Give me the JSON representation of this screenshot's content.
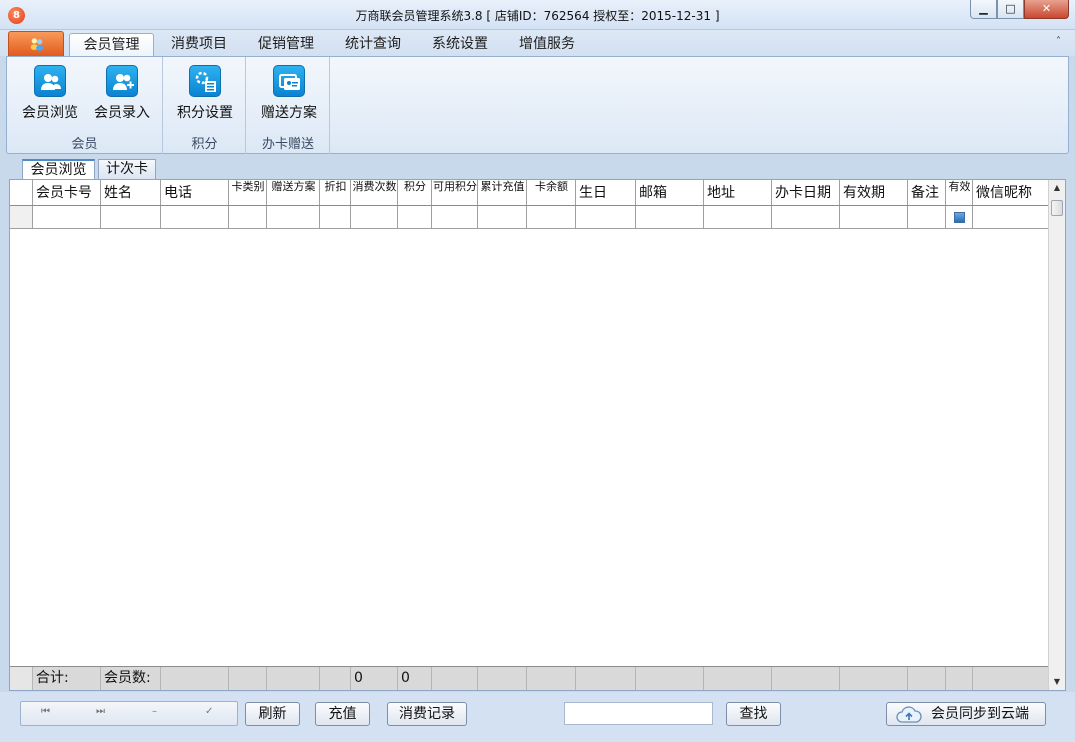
{
  "window": {
    "title": "万商联会员管理系统3.8 [ 店铺ID：762564 授权至：2015-12-31 ]",
    "min_glyph": "▁",
    "max_glyph": "□",
    "close_glyph": "✕"
  },
  "ribbon_tabs": [
    "会员管理",
    "消费项目",
    "促销管理",
    "统计查询",
    "系统设置",
    "增值服务"
  ],
  "ribbon_collapse_glyph": "˄",
  "ribbon_groups": [
    {
      "label": "会员",
      "buttons": [
        {
          "label": "会员浏览",
          "icon": "members-icon"
        },
        {
          "label": "会员录入",
          "icon": "add-member-icon"
        }
      ]
    },
    {
      "label": "积分",
      "buttons": [
        {
          "label": "积分设置",
          "icon": "points-settings-icon"
        }
      ]
    },
    {
      "label": "办卡赠送",
      "buttons": [
        {
          "label": "赠送方案",
          "icon": "gift-plan-icon"
        }
      ]
    }
  ],
  "doc_tabs": [
    "会员浏览",
    "计次卡"
  ],
  "grid": {
    "columns": [
      "会员卡号",
      "姓名",
      "电话",
      "卡类别",
      "赠送方案",
      "折扣",
      "消费次数",
      "积分",
      "可用积分",
      "累计充值",
      "卡余额",
      "生日",
      "邮箱",
      "地址",
      "办卡日期",
      "有效期",
      "备注",
      "有效",
      "微信昵称"
    ],
    "footer": {
      "total_label": "合计:",
      "member_count_label": "会员数:",
      "consume_count_total": "0",
      "points_total": "0"
    }
  },
  "bottom": {
    "nav_first": "⏮",
    "nav_last": "⏭",
    "nav_delete": "–",
    "nav_confirm": "✓",
    "refresh": "刷新",
    "recharge": "充值",
    "consume_record": "消费记录",
    "search_value": "",
    "search": "查找",
    "cloud_sync": "会员同步到云端"
  },
  "colors": {
    "accent_blue": "#0a83d2",
    "orb_orange": "#e25a1d",
    "window_bg": "#c9d9ec"
  }
}
